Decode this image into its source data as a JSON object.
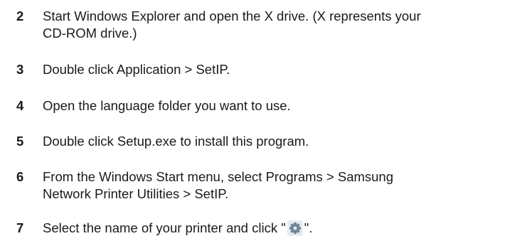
{
  "steps": [
    {
      "number": "2",
      "lines": [
        "Start Windows Explorer and open the X drive. (X represents your",
        "CD-ROM drive.)"
      ]
    },
    {
      "number": "3",
      "lines": [
        "Double click Application > SetIP."
      ]
    },
    {
      "number": "4",
      "lines": [
        "Open the language folder you want to use."
      ]
    },
    {
      "number": "5",
      "lines": [
        "Double click Setup.exe to install this program."
      ]
    },
    {
      "number": "6",
      "lines": [
        "From the Windows Start menu, select Programs > Samsung",
        "Network Printer Utilities > SetIP."
      ]
    },
    {
      "number": "7",
      "text_before_icon": "Select the name of your printer and click \"",
      "icon": "gear-icon",
      "text_after_icon": "\"."
    }
  ]
}
